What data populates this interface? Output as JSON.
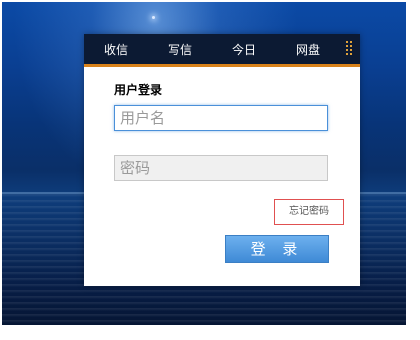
{
  "nav": {
    "items": [
      {
        "label": "收信"
      },
      {
        "label": "写信"
      },
      {
        "label": "今日"
      },
      {
        "label": "网盘"
      }
    ],
    "menu_icon": "grip-icon"
  },
  "login": {
    "title": "用户登录",
    "username_placeholder": "用户名",
    "password_placeholder": "密码",
    "forgot_label": "忘记密码",
    "submit_label": "登 录"
  },
  "colors": {
    "nav_bg": "#0c1a33",
    "nav_accent": "#d9821a",
    "button": "#4a90d9",
    "forgot_border": "#e05050"
  }
}
